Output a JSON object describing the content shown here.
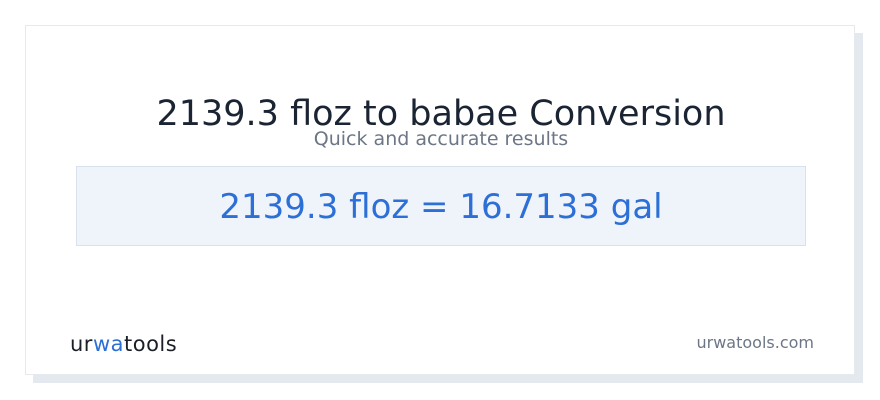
{
  "header": {
    "title": "2139.3 floz to babae Conversion",
    "subtitle": "Quick and accurate results"
  },
  "result": {
    "text": "2139.3 floz = 16.7133 gal"
  },
  "footer": {
    "logo_part1": "ur",
    "logo_accent": "wa",
    "logo_part2": "tools",
    "site_url": "urwatools.com"
  },
  "colors": {
    "accent": "#2c6fd6",
    "title": "#1b2433",
    "muted": "#6c7686",
    "result_bg": "#eff4fa"
  }
}
